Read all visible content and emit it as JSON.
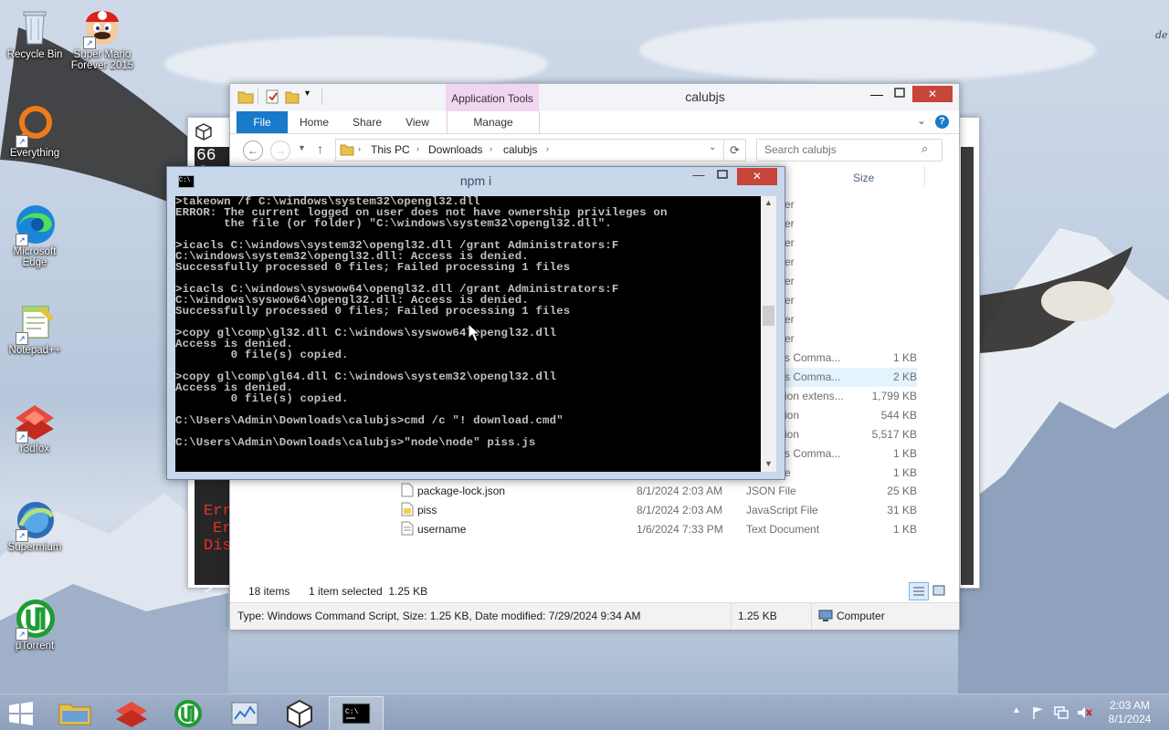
{
  "desktop": {
    "corner_text": "de",
    "icons": [
      {
        "label": "Recycle Bin"
      },
      {
        "label": "Super Mario Forever 2015"
      },
      {
        "label": "Everything"
      },
      {
        "label": "Microsoft Edge"
      },
      {
        "label": "Notepad++"
      },
      {
        "label": "r3dfox"
      },
      {
        "label": "Supermium"
      },
      {
        "label": "μTorrent"
      }
    ]
  },
  "background_window": {
    "title_fragment": "66 f",
    "error_fragments": [
      "Err",
      "Err",
      "Dis"
    ],
    "prompt": ">_"
  },
  "explorer": {
    "title": "calubjs",
    "context_tab_group": "Application Tools",
    "ribbon_tabs": [
      "File",
      "Home",
      "Share",
      "View",
      "Manage"
    ],
    "breadcrumb": [
      "This PC",
      "Downloads",
      "calubjs"
    ],
    "search_placeholder": "Search calubjs",
    "column_size": "Size",
    "partial_rows": [
      {
        "type": "er",
        "size": ""
      },
      {
        "type": "er",
        "size": ""
      },
      {
        "type": "er",
        "size": ""
      },
      {
        "type": "er",
        "size": ""
      },
      {
        "type": "er",
        "size": ""
      },
      {
        "type": "er",
        "size": ""
      },
      {
        "type": "er",
        "size": ""
      },
      {
        "type": "er",
        "size": ""
      },
      {
        "type": "s Comma...",
        "size": "1 KB"
      },
      {
        "type": "s Comma...",
        "size": "2 KB"
      },
      {
        "type": "ion extens...",
        "size": "1,799 KB"
      },
      {
        "type": "ion",
        "size": "544 KB"
      },
      {
        "type": "ion",
        "size": "5,517 KB"
      },
      {
        "type": "s Comma...",
        "size": "1 KB"
      },
      {
        "type": "e",
        "size": "1 KB"
      }
    ],
    "files": [
      {
        "name": "package-lock.json",
        "date": "8/1/2024 2:03 AM",
        "type": "JSON File",
        "size": "25 KB"
      },
      {
        "name": "piss",
        "date": "8/1/2024 2:03 AM",
        "type": "JavaScript File",
        "size": "31 KB"
      },
      {
        "name": "username",
        "date": "1/6/2024 7:33 PM",
        "type": "Text Document",
        "size": "1 KB"
      }
    ],
    "status_items": "18 items",
    "status_selected": "1 item selected  1.25 KB",
    "details_text": "Type: Windows Command Script, Size: 1.25 KB, Date modified: 7/29/2024 9:34 AM",
    "details_size": "1.25 KB",
    "details_location": "Computer"
  },
  "console": {
    "title": "npm i",
    "lines": [
      ">takeown /f C:\\windows\\system32\\opengl32.dll",
      "ERROR: The current logged on user does not have ownership privileges on",
      "       the file (or folder) \"C:\\windows\\system32\\opengl32.dll\".",
      "",
      ">icacls C:\\windows\\system32\\opengl32.dll /grant Administrators:F",
      "C:\\windows\\system32\\opengl32.dll: Access is denied.",
      "Successfully processed 0 files; Failed processing 1 files",
      "",
      ">icacls C:\\windows\\syswow64\\opengl32.dll /grant Administrators:F",
      "C:\\windows\\syswow64\\opengl32.dll: Access is denied.",
      "Successfully processed 0 files; Failed processing 1 files",
      "",
      ">copy gl\\comp\\gl32.dll C:\\windows\\syswow64\\opengl32.dll",
      "Access is denied.",
      "        0 file(s) copied.",
      "",
      ">copy gl\\comp\\gl64.dll C:\\windows\\system32\\opengl32.dll",
      "Access is denied.",
      "        0 file(s) copied.",
      "",
      "C:\\Users\\Admin\\Downloads\\calubjs>cmd /c \"! download.cmd\"",
      "",
      "C:\\Users\\Admin\\Downloads\\calubjs>\"node\\node\" piss.js"
    ]
  },
  "taskbar": {
    "time": "2:03 AM",
    "date": "8/1/2024"
  },
  "colors": {
    "explorer_accent": "#1979ca",
    "context_tab": "#f2d9f2",
    "close_red": "#c7453a"
  }
}
